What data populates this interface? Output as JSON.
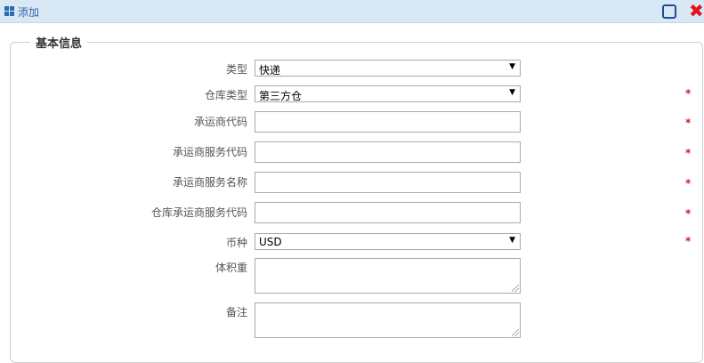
{
  "window": {
    "title": "添加",
    "title_icon": "grid-icon",
    "maximize_icon": "maximize-icon",
    "close_icon": "close-icon",
    "close_glyph": "✖"
  },
  "section": {
    "legend": "基本信息"
  },
  "form": {
    "type": {
      "label": "类型",
      "value": "快递"
    },
    "warehouse_type": {
      "label": "仓库类型",
      "value": "第三方仓"
    },
    "carrier_code": {
      "label": "承运商代码",
      "value": ""
    },
    "carrier_service_code": {
      "label": "承运商服务代码",
      "value": ""
    },
    "carrier_service_name": {
      "label": "承运商服务名称",
      "value": ""
    },
    "warehouse_carrier_service_code": {
      "label": "仓库承运商服务代码",
      "value": ""
    },
    "currency": {
      "label": "币种",
      "value": "USD"
    },
    "volume_weight": {
      "label": "体积重",
      "value": ""
    },
    "remark": {
      "label": "备注",
      "value": ""
    }
  },
  "required_marker": "*",
  "select_arrow": "▼",
  "colors": {
    "titlebar": "#d9e8f5",
    "title_text": "#2f66ad",
    "required": "#e0141e"
  }
}
